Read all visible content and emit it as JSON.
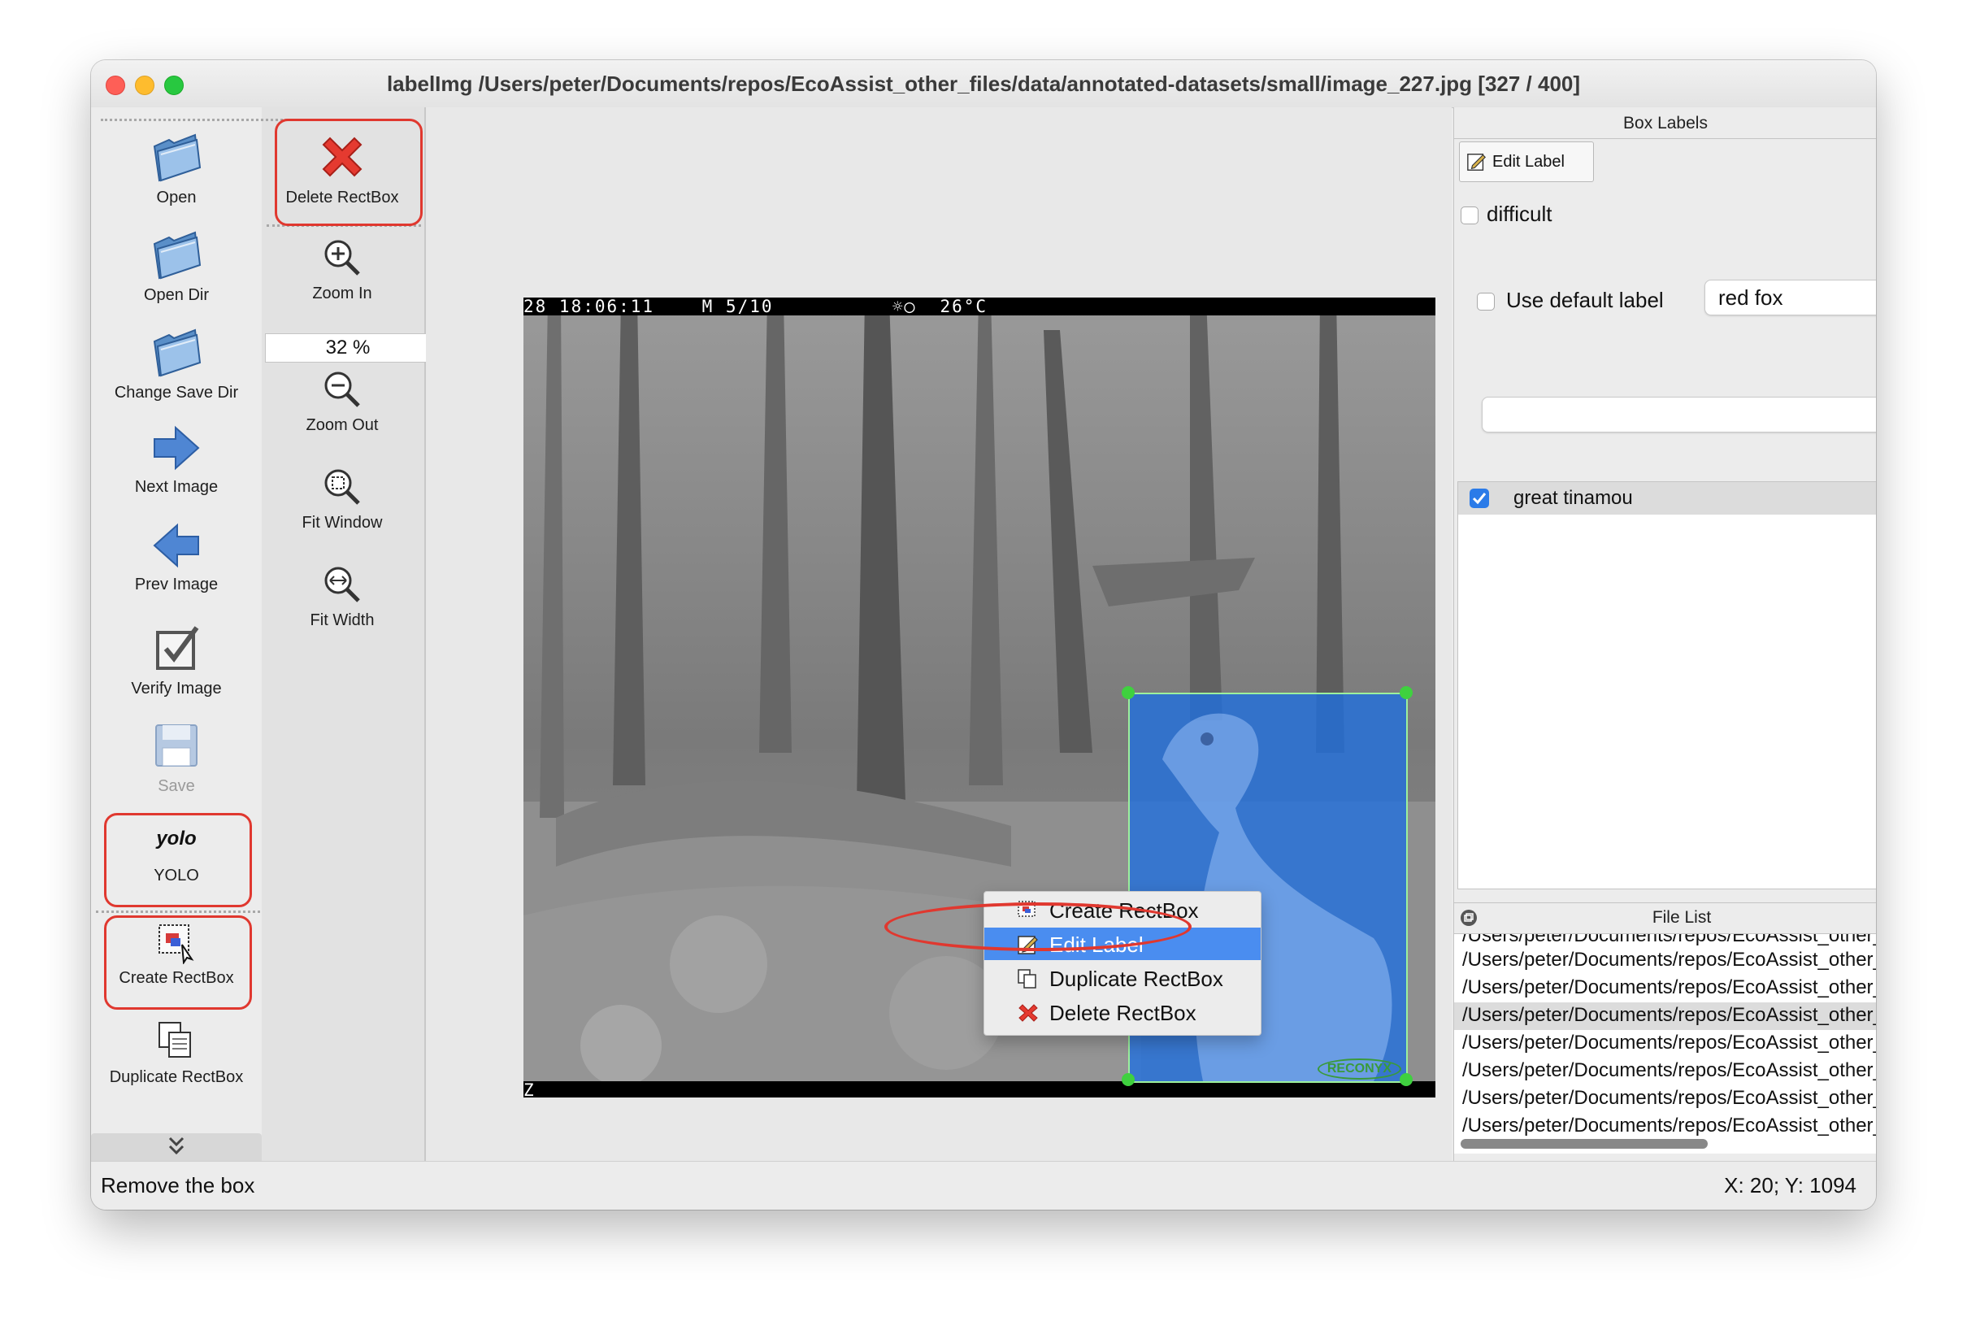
{
  "window": {
    "title": "labelImg /Users/peter/Documents/repos/EcoAssist_other_files/data/annotated-datasets/small/image_227.jpg [327 / 400]"
  },
  "toolbar_left": {
    "open": "Open",
    "open_dir": "Open Dir",
    "change_save_dir": "Change Save Dir",
    "next_image": "Next Image",
    "prev_image": "Prev Image",
    "verify_image": "Verify Image",
    "save": "Save",
    "format_icon_text": "yolo",
    "format": "YOLO",
    "create_rectbox": "Create RectBox",
    "duplicate_rectbox": "Duplicate RectBox"
  },
  "toolbar_right": {
    "delete_rectbox": "Delete RectBox",
    "zoom_in": "Zoom In",
    "zoom_value": "32 %",
    "zoom_out": "Zoom Out",
    "fit_window": "Fit Window",
    "fit_width": "Fit Width"
  },
  "image_overlay": {
    "top_text": "28 18:06:11    M 5/10          ☼◯  26°C",
    "bottom_text": "Z",
    "watermark": "RECONYX"
  },
  "context_menu": {
    "items": [
      "Create RectBox",
      "Edit Label",
      "Duplicate RectBox",
      "Delete RectBox"
    ],
    "selected": "Edit Label"
  },
  "box_labels_panel": {
    "title": "Box Labels",
    "edit_label_button": "Edit Label",
    "difficult": "difficult",
    "use_default_label": "Use default label",
    "default_label_value": "red fox",
    "label_filter_value": "",
    "labels": [
      {
        "name": "great tinamou",
        "checked": true
      }
    ]
  },
  "file_list_panel": {
    "title": "File List",
    "rows": [
      "/Users/peter/Documents/repos/EcoAssist_other_files",
      "/Users/peter/Documents/repos/EcoAssist_other_files",
      "/Users/peter/Documents/repos/EcoAssist_other_files",
      "/Users/peter/Documents/repos/EcoAssist_other_files",
      "/Users/peter/Documents/repos/EcoAssist_other_files",
      "/Users/peter/Documents/repos/EcoAssist_other_files",
      "/Users/peter/Documents/repos/EcoAssist_other_files",
      "/Users/peter/Documents/repos/EcoAssist_other_files"
    ]
  },
  "status_bar": {
    "message": "Remove the box",
    "coordinates": "X: 20; Y: 1094"
  },
  "colors": {
    "highlight_ring": "#e0382f",
    "selection_blue": "#4a8df0",
    "bbox_fill": "#1f6fe0",
    "bbox_handle": "#3fd13f"
  }
}
